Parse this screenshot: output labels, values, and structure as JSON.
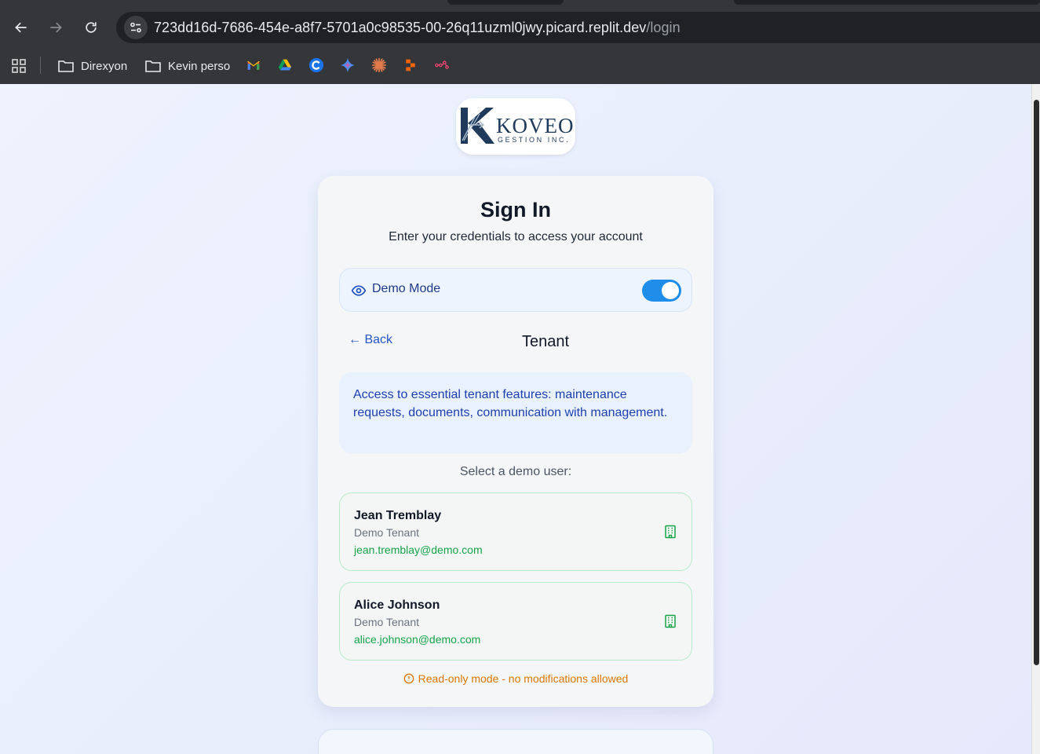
{
  "browser": {
    "url_host": "723dd16d-7686-454e-a8f7-5701a0c98535-00-26q11uzml0jwy.picard.replit.dev",
    "url_path": "/login",
    "bookmarks": [
      {
        "label": "Direxyon",
        "icon": "folder-icon"
      },
      {
        "label": "Kevin perso",
        "icon": "folder-icon"
      }
    ],
    "bookmark_icons": [
      "gmail-icon",
      "google-drive-icon",
      "c-app-icon",
      "gemini-icon",
      "claude-icon",
      "replit-icon",
      "n8n-icon"
    ]
  },
  "logo": {
    "word": "KOVEO",
    "sub": "GESTION INC."
  },
  "signin": {
    "title": "Sign In",
    "subtitle": "Enter your credentials to access your account",
    "demo_mode_label": "Demo Mode",
    "demo_mode_on": true,
    "back_label": "← Back",
    "role_title": "Tenant",
    "role_description": "Access to essential tenant features: maintenance requests, documents, communication with management.",
    "select_label": "Select a demo user:",
    "users": [
      {
        "name": "Jean Tremblay",
        "role": "Demo Tenant",
        "email": "jean.tremblay@demo.com"
      },
      {
        "name": "Alice Johnson",
        "role": "Demo Tenant",
        "email": "alice.johnson@demo.com"
      }
    ],
    "readonly_notice": "Read-only mode - no modifications allowed"
  },
  "colors": {
    "accent": "#1f8eea",
    "link": "#2556c6",
    "success": "#16a34a",
    "warning": "#d97706"
  }
}
